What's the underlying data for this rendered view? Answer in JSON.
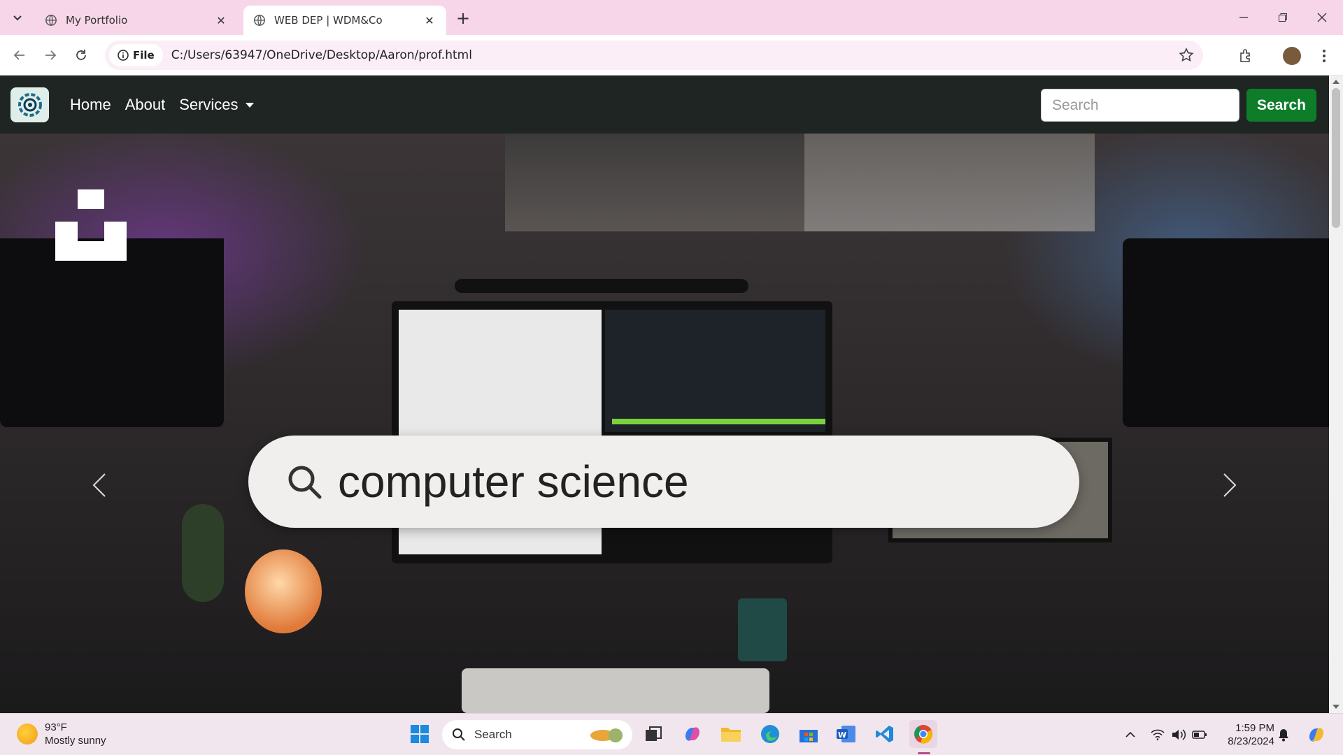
{
  "browser": {
    "tabs": [
      {
        "title": "My Portfolio",
        "active": false
      },
      {
        "title": "WEB DEP | WDM&Co",
        "active": true
      }
    ],
    "file_chip": "File",
    "url": "C:/Users/63947/OneDrive/Desktop/Aaron/prof.html"
  },
  "navbar": {
    "links": [
      "Home",
      "About",
      "Services"
    ],
    "search_placeholder": "Search",
    "search_button": "Search"
  },
  "hero": {
    "search_query": "computer science"
  },
  "taskbar": {
    "weather_temp": "93°F",
    "weather_desc": "Mostly sunny",
    "search_label": "Search",
    "time": "1:59 PM",
    "date": "8/23/2024"
  },
  "colors": {
    "tabbar_bg": "#f6d6e8",
    "navbar_bg": "#1f2522",
    "search_button_bg": "#0e7d2a",
    "taskbar_bg": "#f2e6ee"
  }
}
